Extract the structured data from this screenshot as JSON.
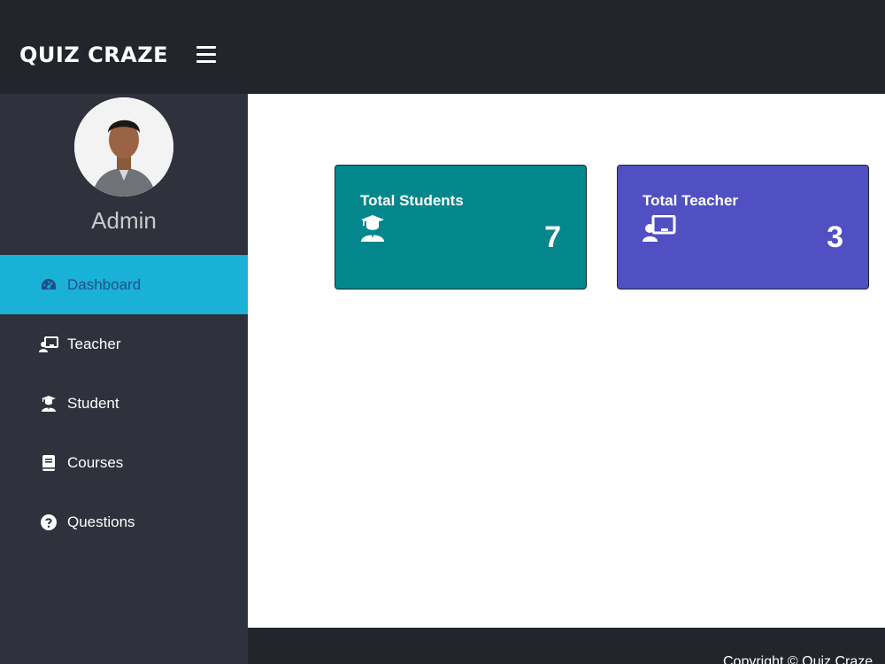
{
  "header": {
    "brand": "QUIZ CRAZE",
    "menu_icon": "hamburger-icon"
  },
  "sidebar": {
    "avatar_icon": "avatar",
    "user_name": "Admin",
    "items": [
      {
        "label": "Dashboard",
        "icon": "dashboard-icon",
        "active": true
      },
      {
        "label": "Teacher",
        "icon": "teacher-icon",
        "active": false
      },
      {
        "label": "Student",
        "icon": "student-icon",
        "active": false
      },
      {
        "label": "Courses",
        "icon": "book-icon",
        "active": false
      },
      {
        "label": "Questions",
        "icon": "question-icon",
        "active": false
      }
    ]
  },
  "cards": [
    {
      "title": "Total Students",
      "count": "7",
      "icon": "student-icon",
      "color": "#03878c"
    },
    {
      "title": "Total Teacher",
      "count": "3",
      "icon": "teacher-icon",
      "color": "#5050c2"
    }
  ],
  "footer": {
    "text": "Copyright © Quiz Craze"
  },
  "colors": {
    "topbar": "#23252d",
    "sidebar": "#2f313c",
    "active": "#19b2d6"
  }
}
